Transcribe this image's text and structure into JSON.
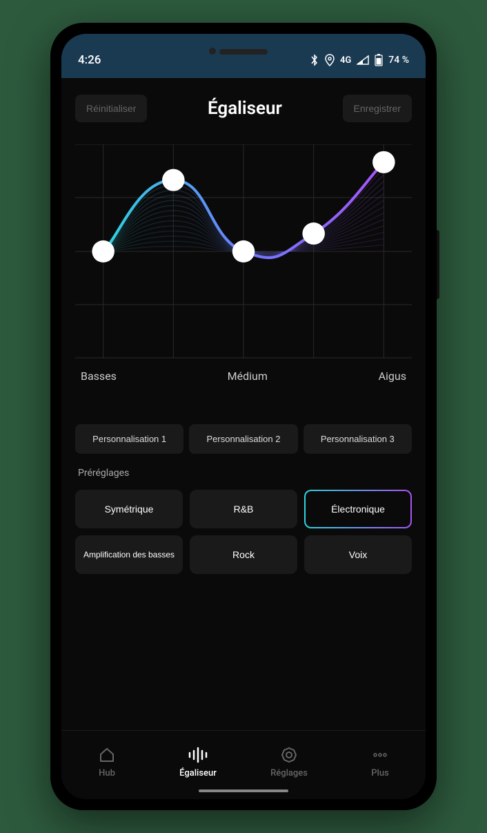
{
  "status": {
    "time": "4:26",
    "network": "4G",
    "battery": "74 %"
  },
  "header": {
    "reset": "Réinitialiser",
    "title": "Égaliseur",
    "save": "Enregistrer"
  },
  "chart_data": {
    "type": "line",
    "categories": [
      "Basses",
      "",
      "Médium",
      "",
      "Aigus"
    ],
    "values": [
      0,
      2,
      0,
      0.5,
      2.5
    ],
    "xlabel": "",
    "ylabel": "",
    "ylim": [
      -3,
      3
    ],
    "title": "",
    "gradient": [
      "#2dd4e0",
      "#6d7cff",
      "#a855f7"
    ]
  },
  "axis": {
    "low": "Basses",
    "mid": "Médium",
    "high": "Aigus"
  },
  "custom_presets": {
    "p1": "Personnalisation 1",
    "p2": "Personnalisation 2",
    "p3": "Personnalisation 3"
  },
  "presets_label": "Préréglages",
  "presets": {
    "symmetric": "Symétrique",
    "rnb": "R&B",
    "electronic": "Électronique",
    "bass_boost": "Amplification des basses",
    "rock": "Rock",
    "voice": "Voix"
  },
  "selected_preset": "electronic",
  "nav": {
    "hub": "Hub",
    "eq": "Égaliseur",
    "settings": "Réglages",
    "more": "Plus"
  }
}
